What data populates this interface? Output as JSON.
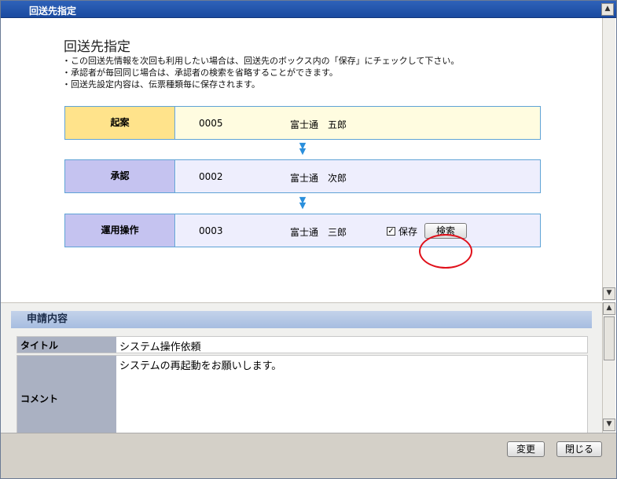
{
  "window": {
    "title": "回送先指定"
  },
  "page": {
    "heading": "回送先指定",
    "notes": [
      "・この回送先情報を次回も利用したい場合は、回送先のボックス内の「保存」にチェックして下さい。",
      "・承認者が毎回同じ場合は、承認者の検索を省略することができます。",
      "・回送先設定内容は、伝票種類毎に保存されます。"
    ]
  },
  "route": {
    "steps": [
      {
        "label": "起案",
        "code": "0005",
        "name": "富士通　五郎"
      },
      {
        "label": "承認",
        "code": "0002",
        "name": "富士通　次郎"
      },
      {
        "label": "運用操作",
        "code": "0003",
        "name": "富士通　三郎",
        "save_label": "保存",
        "save_checked": true,
        "search_label": "検索"
      }
    ],
    "arrow_glyph": "▼"
  },
  "application": {
    "header": "申請内容",
    "fields": [
      {
        "key": "タイトル",
        "value": "システム操作依頼"
      },
      {
        "key": "コメント",
        "value": "システムの再起動をお願いします。"
      }
    ]
  },
  "footer": {
    "change_label": "変更",
    "close_label": "閉じる"
  },
  "colors": {
    "accent_title": "#1a4aa0",
    "step_draft": "#ffe38b",
    "step_approve": "#c5c3f0",
    "highlight": "#e0101a"
  }
}
